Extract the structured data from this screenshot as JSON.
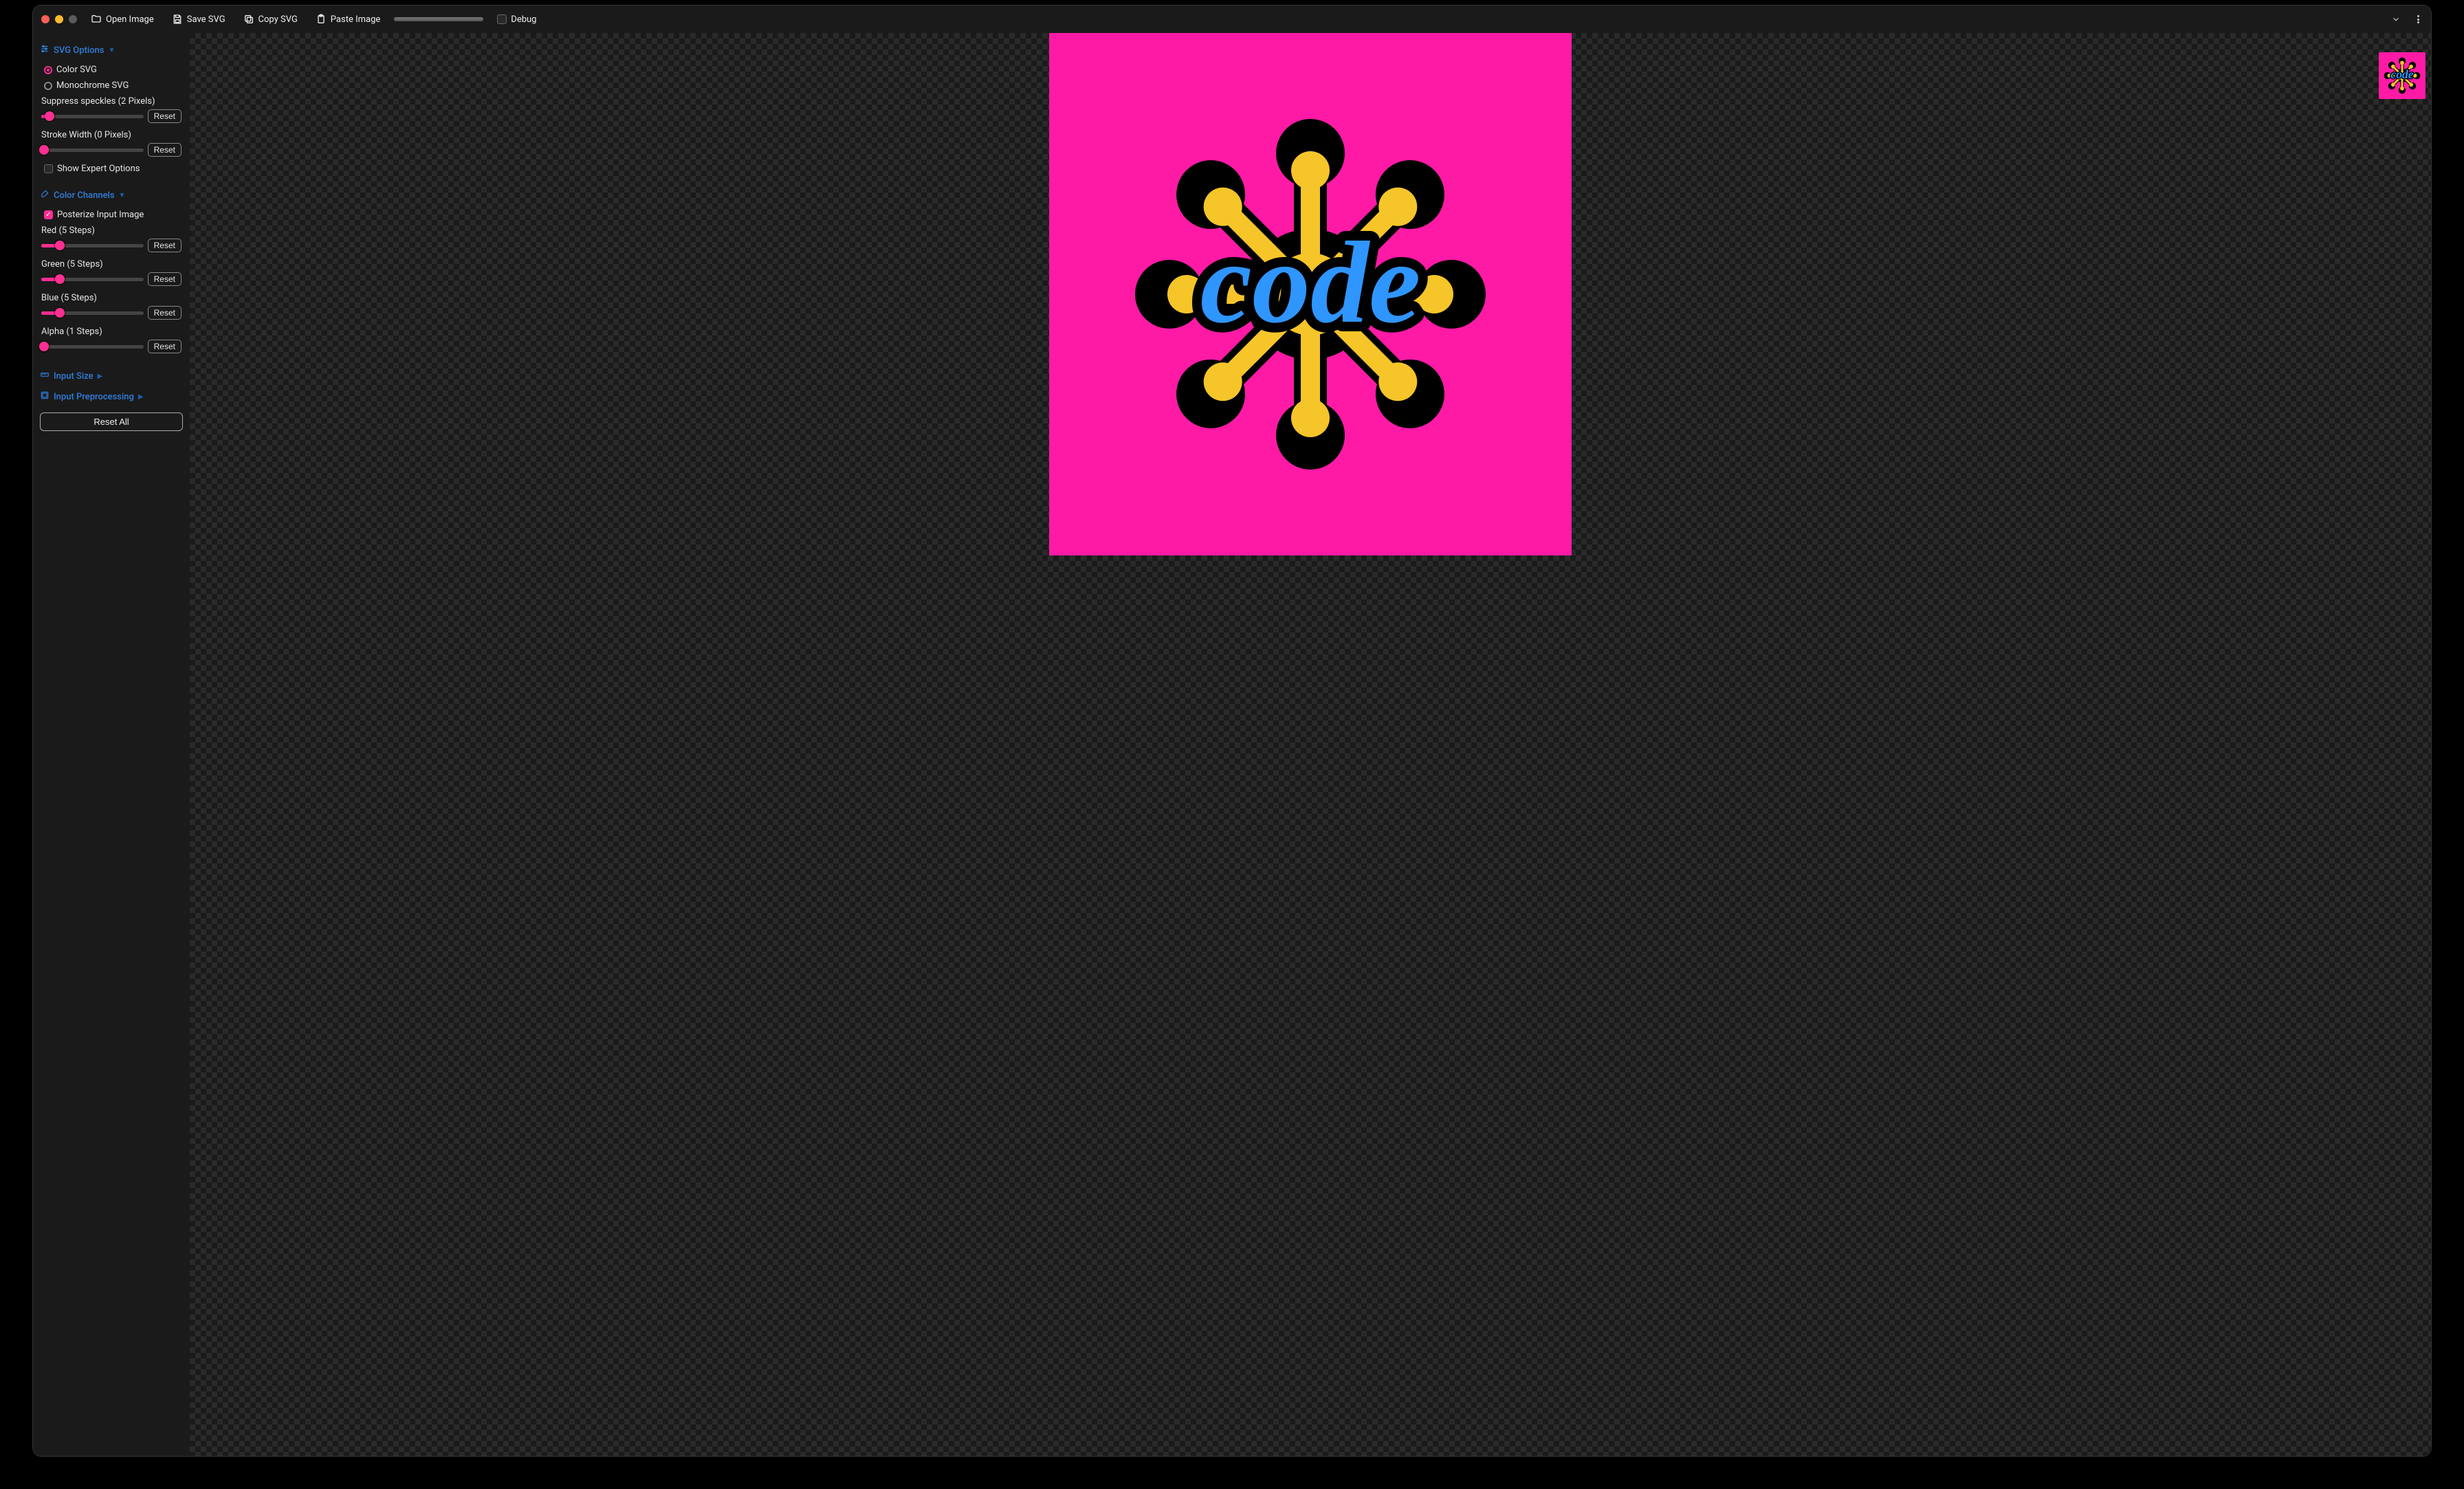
{
  "toolbar": {
    "open_image": "Open Image",
    "save_svg": "Save SVG",
    "copy_svg": "Copy SVG",
    "paste_image": "Paste Image",
    "debug": "Debug",
    "debug_checked": false
  },
  "sections": {
    "svg_options": {
      "title": "SVG Options",
      "expanded": true,
      "mode": "color",
      "color_label": "Color SVG",
      "mono_label": "Monochrome SVG",
      "suppress_speckles": {
        "label": "Suppress speckles (2 Pixels)",
        "value": 2,
        "min": 0,
        "max": 50,
        "pct": 8
      },
      "stroke_width": {
        "label": "Stroke Width (0 Pixels)",
        "value": 0,
        "min": 0,
        "max": 50,
        "pct": 3
      },
      "show_expert": {
        "label": "Show Expert Options",
        "checked": false
      },
      "reset_label": "Reset"
    },
    "color_channels": {
      "title": "Color Channels",
      "expanded": true,
      "posterize": {
        "label": "Posterize Input Image",
        "checked": true
      },
      "red": {
        "label": "Red (5 Steps)",
        "value": 5,
        "pct": 18
      },
      "green": {
        "label": "Green (5 Steps)",
        "value": 5,
        "pct": 18
      },
      "blue": {
        "label": "Blue (5 Steps)",
        "value": 5,
        "pct": 18
      },
      "alpha": {
        "label": "Alpha (1 Steps)",
        "value": 1,
        "pct": 3
      },
      "reset_label": "Reset"
    },
    "input_size": {
      "title": "Input Size",
      "expanded": false
    },
    "input_preprocessing": {
      "title": "Input Preprocessing",
      "expanded": false
    }
  },
  "reset_all": "Reset All",
  "colors": {
    "accent": "#ff2e92",
    "link": "#2f7edb",
    "canvas_bg": "#ff1aa6",
    "logo_blue": "#2f95ff",
    "logo_yellow": "#f6c52a",
    "logo_black": "#000000"
  },
  "artwork": {
    "text": "code"
  }
}
